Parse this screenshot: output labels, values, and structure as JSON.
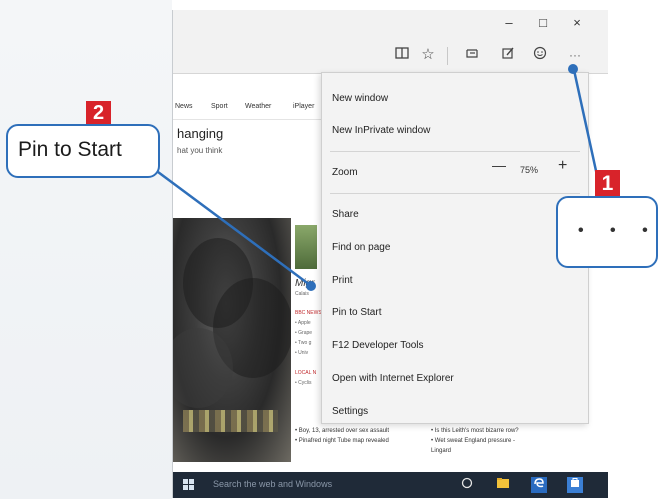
{
  "window": {
    "minimize_glyph": "–",
    "maximize_glyph": "□",
    "close_glyph": "×"
  },
  "toolbar": {
    "icons": [
      "reading-view-icon",
      "favorites-star-icon",
      "hub-icon",
      "web-note-icon",
      "share-smiley-icon",
      "more-actions-icon"
    ],
    "more_glyph": "···"
  },
  "page": {
    "nav_tabs": [
      "News",
      "Sport",
      "Weather",
      "iPlayer"
    ],
    "headline": "hanging",
    "subline": "hat you think",
    "article_title": "Migr",
    "article_sub": "Calais",
    "section_label": "BBC NEWS",
    "bullets": [
      "• Apple",
      "• Grape",
      "• Two g",
      "• Univ"
    ],
    "local_label": "LOCAL N",
    "local_bullets": [
      "• Cyclis"
    ],
    "bottom_news_left": [
      "• Boy, 13, arrested over sex assault",
      "• Pinafred night Tube map revealed"
    ],
    "bottom_news_right": [
      "• Is this Leith's most bizarre row?",
      "• Wet sweat England pressure -",
      "  Lingard"
    ]
  },
  "menu": {
    "new_window": "New window",
    "new_inprivate": "New InPrivate window",
    "zoom_label": "Zoom",
    "zoom_minus": "—",
    "zoom_value": "75%",
    "zoom_plus": "+",
    "share": "Share",
    "find_on_page": "Find on page",
    "print": "Print",
    "pin_to_start": "Pin to Start",
    "f12_tools": "F12 Developer Tools",
    "open_ie": "Open with Internet Explorer",
    "settings": "Settings"
  },
  "taskbar": {
    "search_placeholder": "Search the web and Windows"
  },
  "callouts": {
    "step1_badge": "1",
    "step2_badge": "2",
    "step2_text": "Pin to Start",
    "step1_glyph": "• • •"
  },
  "colors": {
    "callout_blue": "#2e6fba",
    "badge_red": "#d8232a",
    "taskbar": "#1f2a38"
  }
}
